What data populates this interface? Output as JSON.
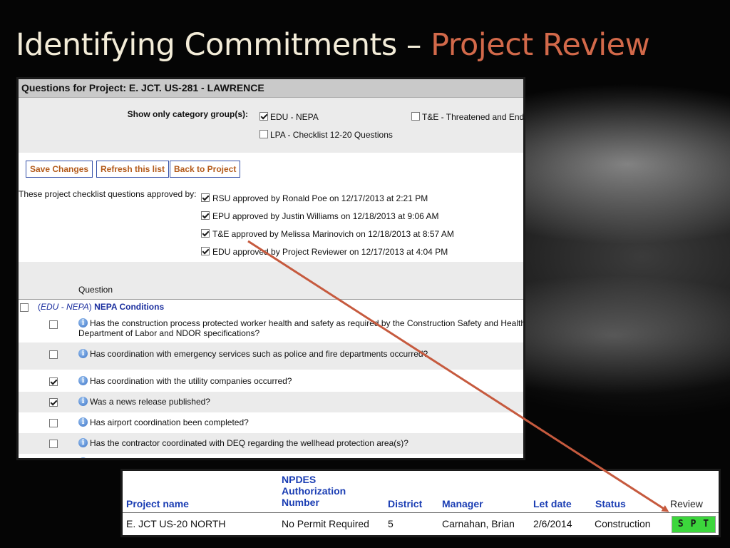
{
  "slide": {
    "title_main": "Identifying Commitments – ",
    "title_accent": "Project Review"
  },
  "colors": {
    "accent": "#d2694a",
    "title": "#f3ecd8",
    "link_blue": "#1a3db3",
    "button_text": "#b35a1a",
    "review_green": "#3cd63c",
    "arrow": "#c65a3e"
  },
  "panel": {
    "header": "Questions for Project: E. JCT. US-281 - LAWRENCE",
    "category_label": "Show only category group(s):",
    "categories": [
      {
        "label": "EDU - NEPA",
        "checked": true
      },
      {
        "label": "T&E - Threatened and Endangered Species",
        "checked": false
      },
      {
        "label": "LPA - Checklist 12-20 Questions",
        "checked": false
      }
    ],
    "buttons": {
      "save": "Save Changes",
      "refresh": "Refresh this list",
      "back": "Back to Project"
    },
    "approved_label": "These project checklist questions approved by:",
    "approvals": [
      {
        "text": "RSU approved by Ronald Poe on 12/17/2013 at 2:21 PM",
        "checked": true
      },
      {
        "text": "EPU approved by Justin Williams on 12/18/2013 at 9:06 AM",
        "checked": true
      },
      {
        "text": "T&E approved by Melissa Marinovich on 12/18/2013 at 8:57 AM",
        "checked": true
      },
      {
        "text": "EDU approved by Project Reviewer on 12/17/2013 at 4:04 PM",
        "checked": true
      }
    ],
    "column_header": "Question",
    "group": {
      "category": "EDU - NEPA",
      "name": "NEPA Conditions",
      "open_paren": "(",
      "close_paren": ")"
    },
    "questions": [
      {
        "line1": "Has the construction process protected worker health and safety as required by the Construction Safety and Health",
        "line2": "Department of Labor and NDOR specifications?",
        "checked": false
      },
      {
        "line1": "Has coordination with emergency services such as police and fire departments occurred?",
        "line2": "",
        "checked": false
      },
      {
        "line1": "Has coordination with the utility companies occurred?",
        "line2": "",
        "checked": true
      },
      {
        "line1": "Was a news release published?",
        "line2": "",
        "checked": true
      },
      {
        "line1": "Has airport coordination been completed?",
        "line2": "",
        "checked": false
      },
      {
        "line1": "Has the contractor coordinated with DEQ regarding the wellhead protection area(s)?",
        "line2": "",
        "checked": false
      }
    ]
  },
  "table": {
    "headers": {
      "project_name": "Project name",
      "npdes_1": "NPDES",
      "npdes_2": "Authorization",
      "npdes_3": "Number",
      "district": "District",
      "manager": "Manager",
      "let_date": "Let date",
      "status": "Status",
      "review": "Review"
    },
    "row": {
      "project_name": "E. JCT US-20 NORTH",
      "npdes": "No Permit Required",
      "district": "5",
      "manager": "Carnahan, Brian",
      "let_date": "2/6/2014",
      "status": "Construction",
      "review": "S P T D"
    }
  }
}
